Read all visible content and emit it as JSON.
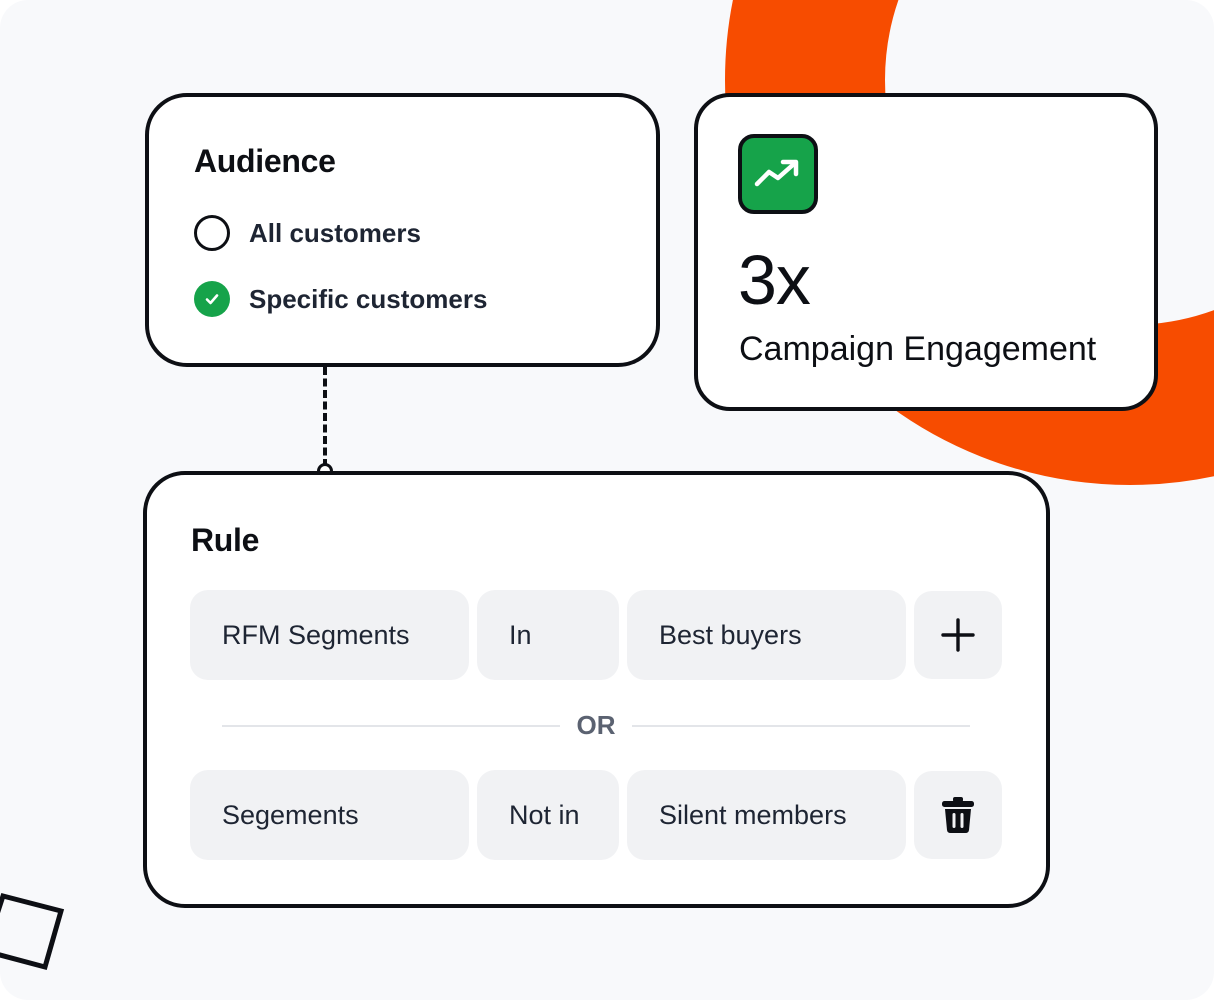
{
  "colors": {
    "accent": "#F74C00",
    "success": "#16A34A",
    "ink": "#0D0F14",
    "pill": "#F1F2F4"
  },
  "audience": {
    "title": "Audience",
    "options": [
      {
        "label": "All customers",
        "selected": false
      },
      {
        "label": "Specific customers",
        "selected": true
      }
    ]
  },
  "engagement": {
    "icon": "trending-up-icon",
    "value": "3x",
    "label": "Campaign Engagement"
  },
  "rule": {
    "title": "Rule",
    "separator": "OR",
    "conditions": [
      {
        "field": "RFM Segments",
        "operator": "In",
        "value": "Best buyers",
        "action_icon": "plus-icon"
      },
      {
        "field": "Segements",
        "operator": "Not in",
        "value": "Silent members",
        "action_icon": "trash-icon"
      }
    ]
  }
}
